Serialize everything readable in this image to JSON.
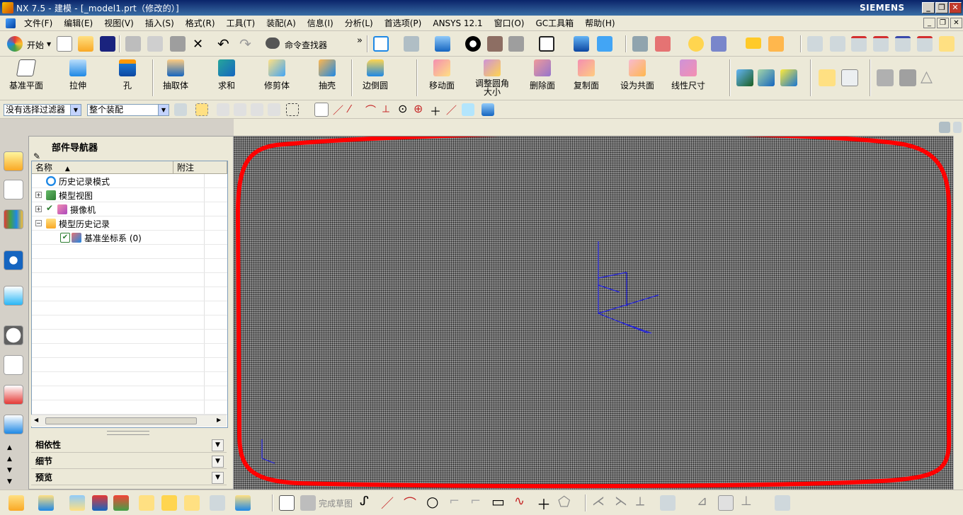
{
  "window": {
    "title": "NX 7.5 - 建模 - [_model1.prt（修改的）]",
    "brand": "SIEMENS",
    "minimize": "_",
    "restore": "❐",
    "close": "✕"
  },
  "menu": {
    "items": [
      "文件(F)",
      "编辑(E)",
      "视图(V)",
      "插入(S)",
      "格式(R)",
      "工具(T)",
      "装配(A)",
      "信息(I)",
      "分析(L)",
      "首选项(P)",
      "ANSYS 12.1",
      "窗口(O)",
      "GC工具箱",
      "帮助(H)"
    ],
    "doc_minimize": "_",
    "doc_restore": "❐",
    "doc_close": "✕"
  },
  "toolbar1": {
    "start_label": "开始",
    "command_finder_label": "命令查找器",
    "more_glyph": "»"
  },
  "toolbar2": {
    "buttons": [
      "基准平面",
      "拉伸",
      "孔",
      "抽取体",
      "求和",
      "修剪体",
      "抽壳",
      "边倒圆",
      "移动面",
      "调整圆角大小",
      "删除面",
      "复制面",
      "设为共面",
      "线性尺寸"
    ]
  },
  "toolbar3": {
    "filter_value": "没有选择过滤器",
    "scope_value": "整个装配"
  },
  "nav": {
    "title": "部件导航器",
    "col_name": "名称",
    "col_notes": "附注",
    "sort_arrow": "▲",
    "tree": [
      {
        "label": "历史记录模式",
        "icon": "clock-icon"
      },
      {
        "label": "模型视图",
        "icon": "model-views-icon",
        "expander": "+"
      },
      {
        "label": "摄像机",
        "icon": "camera-icon",
        "expander": "+"
      },
      {
        "label": "模型历史记录",
        "icon": "folder-icon",
        "expander": "−"
      },
      {
        "label": "基准坐标系 (0)",
        "icon": "datum-csys-icon"
      }
    ],
    "panels": [
      "相依性",
      "细节",
      "预览"
    ]
  },
  "bottombar": {
    "finish_sketch_label": "完成草图"
  },
  "colors": {
    "annotation_red": "#ff0000",
    "csys_blue": "#2020e0",
    "title_blue": "#0a246a"
  }
}
